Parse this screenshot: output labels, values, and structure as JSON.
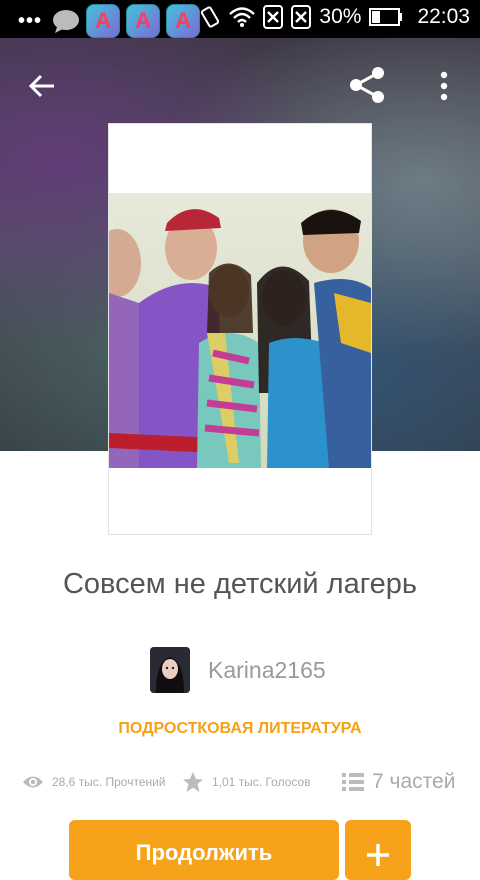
{
  "status_bar": {
    "dots": "•••",
    "app_letter": "A",
    "battery_percent": "30%",
    "time": "22:03"
  },
  "story": {
    "title": "Совсем не детский лагерь",
    "author": "Karina2165",
    "genre": "ПОДРОСТКОВАЯ ЛИТЕРАТУРА",
    "reads": "28,6 тыс. Прочтений",
    "votes": "1,01 тыс. Голосов",
    "parts": "7 частей"
  },
  "actions": {
    "continue_label": "Продолжить",
    "add_label": "+"
  },
  "colors": {
    "accent": "#f7a21b",
    "genre": "#f5a018",
    "status_bar": "#000000"
  },
  "icons": {
    "back": "arrow-left-icon",
    "share": "share-icon",
    "more": "more-vertical-icon",
    "reads": "eye-icon",
    "votes": "star-icon",
    "parts": "list-icon"
  }
}
